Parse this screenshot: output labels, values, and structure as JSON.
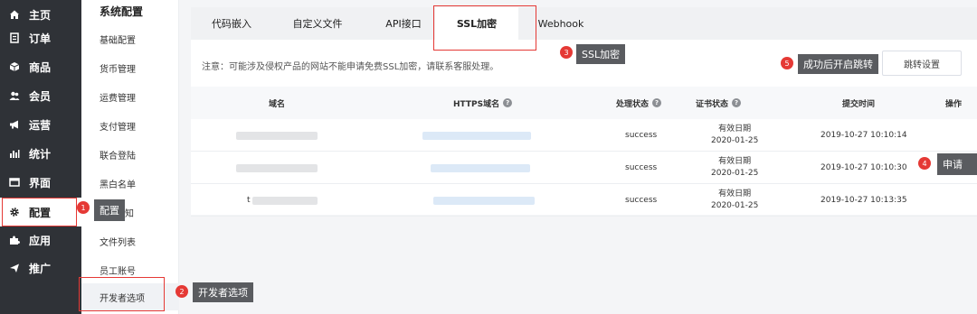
{
  "sidebar": {
    "items": [
      {
        "label": "主页",
        "icon": "home-icon"
      },
      {
        "label": "订单",
        "icon": "order-icon"
      },
      {
        "label": "商品",
        "icon": "product-icon"
      },
      {
        "label": "会员",
        "icon": "member-icon"
      },
      {
        "label": "运营",
        "icon": "megaphone-icon"
      },
      {
        "label": "统计",
        "icon": "bar-chart-icon"
      },
      {
        "label": "界面",
        "icon": "window-icon"
      },
      {
        "label": "配置",
        "icon": "gear-icon"
      },
      {
        "label": "应用",
        "icon": "puzzle-icon"
      },
      {
        "label": "推广",
        "icon": "send-icon"
      }
    ]
  },
  "submenu": {
    "title": "系统配置",
    "items": [
      "基础配置",
      "货币管理",
      "运费管理",
      "支付管理",
      "联合登陆",
      "黑白名单",
      "知",
      "文件列表",
      "员工账号",
      "开发者选项"
    ]
  },
  "tabs": [
    "代码嵌入",
    "自定义文件",
    "API接口",
    "SSL加密",
    "Webhook"
  ],
  "notice": "注意：可能涉及侵权产品的网站不能申请免费SSL加密，请联系客服处理。",
  "redirect_button": "跳转设置",
  "table": {
    "headers": [
      "域名",
      "HTTPS域名",
      "处理状态",
      "证书状态",
      "提交时间",
      "操作"
    ],
    "rows": [
      {
        "status": "success",
        "cert_label": "有效日期",
        "cert_date": "2020-01-25",
        "time": "2019-10-27 10:10:14"
      },
      {
        "status": "success",
        "cert_label": "有效日期",
        "cert_date": "2020-01-25",
        "time": "2019-10-27 10:10:30"
      },
      {
        "prefix": "t",
        "status": "success",
        "cert_label": "有效日期",
        "cert_date": "2020-01-25",
        "time": "2019-10-27 10:13:35"
      }
    ]
  },
  "annotations": [
    {
      "num": "1",
      "text": "配置"
    },
    {
      "num": "2",
      "text": "开发者选项"
    },
    {
      "num": "3",
      "text": "SSL加密"
    },
    {
      "num": "4",
      "text": "申请"
    },
    {
      "num": "5",
      "text": "成功后开启跳转"
    }
  ],
  "colors": {
    "sidebar_bg": "#2f3237",
    "annotation_red": "#e53935",
    "tooltip_bg": "#5a5c60"
  }
}
